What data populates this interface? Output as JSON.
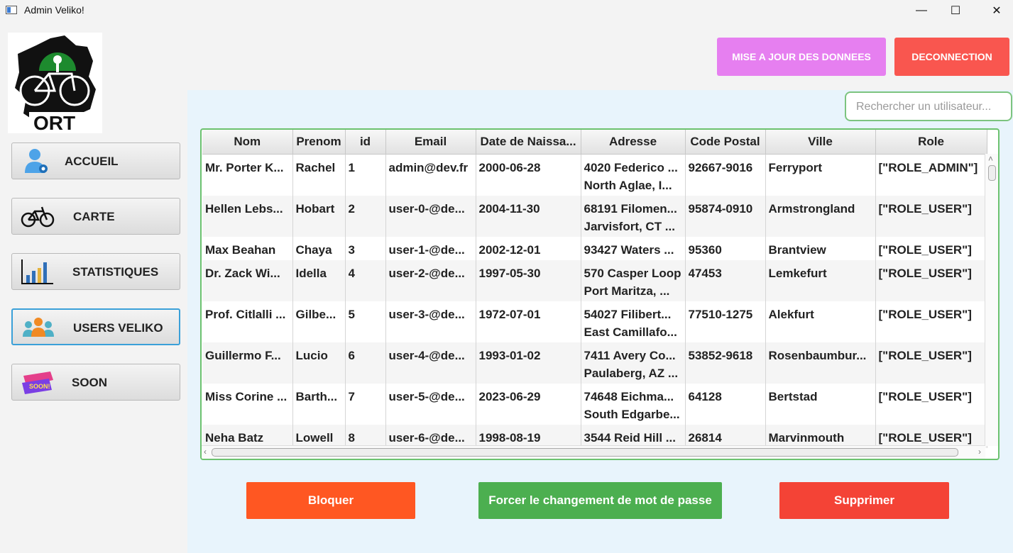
{
  "window": {
    "title": "Admin Veliko!",
    "minimize": "—",
    "maximize": "☐",
    "close": "✕"
  },
  "logo": {
    "text": "ORT"
  },
  "nav": [
    {
      "label": "ACCUEIL",
      "icon": "user-gear-icon"
    },
    {
      "label": "CARTE",
      "icon": "bicycle-icon"
    },
    {
      "label": "STATISTIQUES",
      "icon": "bar-chart-icon"
    },
    {
      "label": "USERS VELIKO",
      "icon": "users-group-icon"
    },
    {
      "label": "SOON",
      "icon": "coming-soon-icon"
    }
  ],
  "top_buttons": {
    "update": "MISE A JOUR DES DONNEES",
    "logout": "DECONNECTION"
  },
  "search": {
    "placeholder": "Rechercher un utilisateur..."
  },
  "table": {
    "columns": [
      "Nom",
      "Prenom",
      "id",
      "Email",
      "Date de Naissa...",
      "Adresse",
      "Code Postal",
      "Ville",
      "Role"
    ],
    "rows": [
      {
        "nom": "Mr. Porter K...",
        "prenom": "Rachel",
        "id": "1",
        "email": "admin@dev.fr",
        "date": "2000-06-28",
        "adresse1": "4020 Federico ...",
        "adresse2": "North Aglae, I...",
        "cp": "92667-9016",
        "ville": "Ferryport",
        "role": "[\"ROLE_ADMIN\"]"
      },
      {
        "nom": "Hellen Lebs...",
        "prenom": "Hobart",
        "id": "2",
        "email": "user-0-@de...",
        "date": "2004-11-30",
        "adresse1": "68191 Filomen...",
        "adresse2": "Jarvisfort, CT ...",
        "cp": "95874-0910",
        "ville": "Armstrongland",
        "role": "[\"ROLE_USER\"]"
      },
      {
        "nom": "Max Beahan",
        "prenom": "Chaya",
        "id": "3",
        "email": "user-1-@de...",
        "date": "2002-12-01",
        "adresse1": "93427 Waters ...",
        "adresse2": "",
        "cp": "95360",
        "ville": "Brantview",
        "role": "[\"ROLE_USER\"]"
      },
      {
        "nom": "Dr. Zack Wi...",
        "prenom": "Idella",
        "id": "4",
        "email": "user-2-@de...",
        "date": "1997-05-30",
        "adresse1": "570 Casper Loop",
        "adresse2": "Port Maritza, ...",
        "cp": "47453",
        "ville": "Lemkefurt",
        "role": "[\"ROLE_USER\"]"
      },
      {
        "nom": "Prof. Citlalli ...",
        "prenom": "Gilbe...",
        "id": "5",
        "email": "user-3-@de...",
        "date": "1972-07-01",
        "adresse1": "54027 Filibert...",
        "adresse2": "East Camillafo...",
        "cp": "77510-1275",
        "ville": "Alekfurt",
        "role": "[\"ROLE_USER\"]"
      },
      {
        "nom": "Guillermo F...",
        "prenom": "Lucio",
        "id": "6",
        "email": "user-4-@de...",
        "date": "1993-01-02",
        "adresse1": "7411 Avery Co...",
        "adresse2": "Paulaberg, AZ ...",
        "cp": "53852-9618",
        "ville": "Rosenbaumbur...",
        "role": "[\"ROLE_USER\"]"
      },
      {
        "nom": "Miss Corine ...",
        "prenom": "Barth...",
        "id": "7",
        "email": "user-5-@de...",
        "date": "2023-06-29",
        "adresse1": "74648 Eichma...",
        "adresse2": "South Edgarbe...",
        "cp": "64128",
        "ville": "Bertstad",
        "role": "[\"ROLE_USER\"]"
      },
      {
        "nom": "Neha Batz",
        "prenom": "Lowell",
        "id": "8",
        "email": "user-6-@de...",
        "date": "1998-08-19",
        "adresse1": "3544 Reid Hill ...",
        "adresse2": "",
        "cp": "26814",
        "ville": "Marvinmouth",
        "role": "[\"ROLE_USER\"]"
      }
    ]
  },
  "actions": {
    "block": "Bloquer",
    "force_password": "Forcer le changement de mot de passe",
    "delete": "Supprimer"
  },
  "colors": {
    "update": "#e67ff0",
    "logout": "#f9564f",
    "block": "#ff5722",
    "force": "#4caf50",
    "delete": "#f44336",
    "table_border": "#6cc26f",
    "content_bg": "#e8f4fc"
  }
}
